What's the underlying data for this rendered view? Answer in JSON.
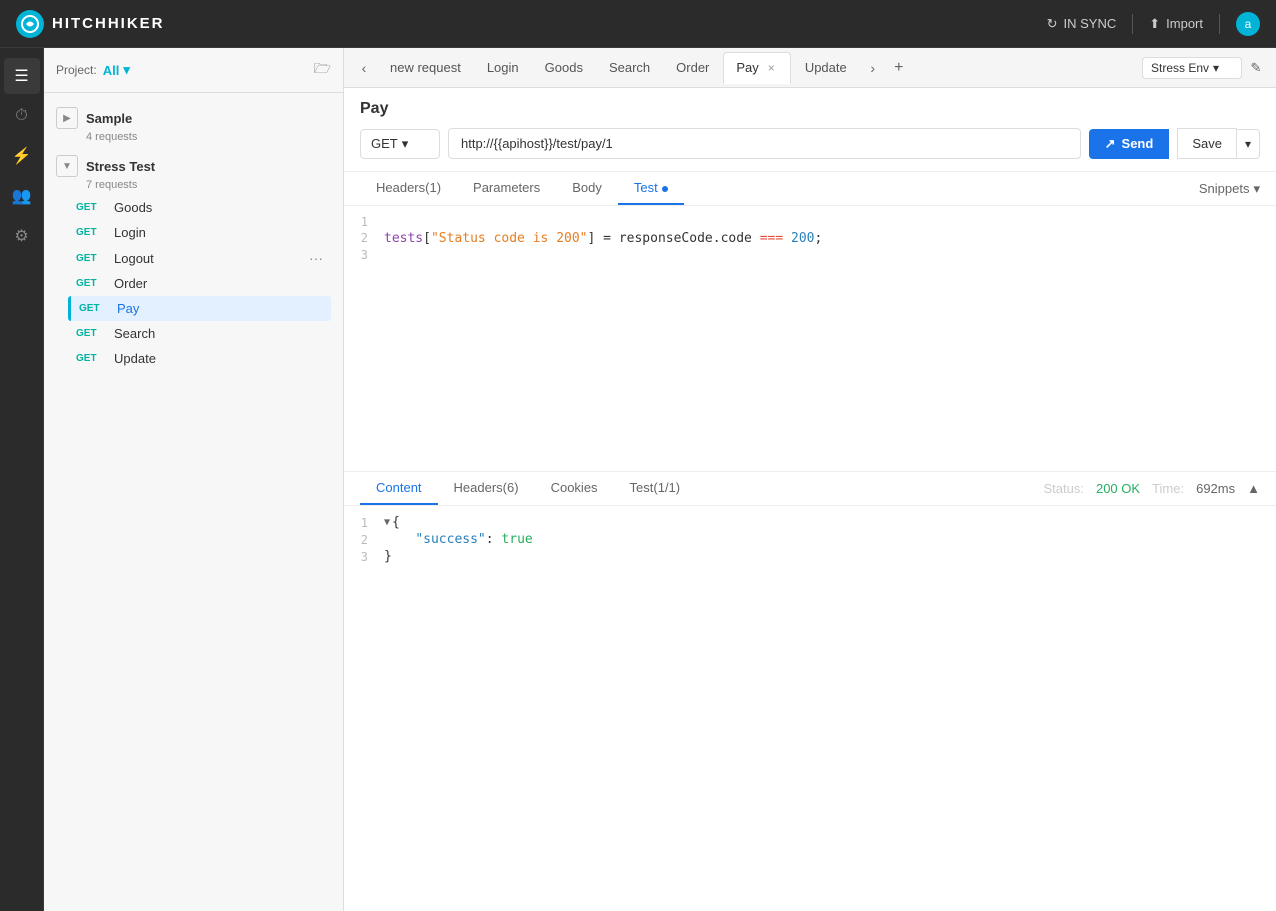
{
  "app": {
    "title": "HITCHHIKER",
    "logo_text": "HITCHHIKER"
  },
  "navbar": {
    "sync_label": "IN SYNC",
    "import_label": "Import",
    "user_initial": "a"
  },
  "sidebar": {
    "icons": [
      {
        "name": "collection-icon",
        "symbol": "☰"
      },
      {
        "name": "history-icon",
        "symbol": "🕐"
      },
      {
        "name": "environment-icon",
        "symbol": "⚡"
      },
      {
        "name": "team-icon",
        "symbol": "👥"
      },
      {
        "name": "settings-icon",
        "symbol": "⚙"
      }
    ]
  },
  "left_panel": {
    "project_label": "Project:",
    "project_value": "All",
    "collections": [
      {
        "name": "Sample",
        "meta": "4 requests",
        "requests": []
      },
      {
        "name": "Stress Test",
        "meta": "7 requests",
        "requests": [
          {
            "method": "GET",
            "name": "Goods",
            "active": false
          },
          {
            "method": "GET",
            "name": "Login",
            "active": false
          },
          {
            "method": "GET",
            "name": "Logout",
            "active": false
          },
          {
            "method": "GET",
            "name": "Order",
            "active": false
          },
          {
            "method": "GET",
            "name": "Pay",
            "active": true
          },
          {
            "method": "GET",
            "name": "Search",
            "active": false
          },
          {
            "method": "GET",
            "name": "Update",
            "active": false
          }
        ]
      }
    ]
  },
  "tabs": [
    {
      "label": "new request",
      "closable": false
    },
    {
      "label": "Login",
      "closable": false
    },
    {
      "label": "Goods",
      "closable": false
    },
    {
      "label": "Search",
      "closable": false
    },
    {
      "label": "Order",
      "closable": false
    },
    {
      "label": "Pay",
      "closable": true,
      "active": true
    },
    {
      "label": "Update",
      "closable": false
    }
  ],
  "env_selector": {
    "value": "Stress Env"
  },
  "request": {
    "title": "Pay",
    "method": "GET",
    "url": "http://{{apihost}}/test/pay/1",
    "sub_tabs": [
      {
        "label": "Headers(1)",
        "active": false
      },
      {
        "label": "Parameters",
        "active": false
      },
      {
        "label": "Body",
        "active": false
      },
      {
        "label": "Test",
        "active": true,
        "dot": true
      }
    ],
    "snippets_label": "Snippets",
    "send_label": "Send",
    "save_label": "Save"
  },
  "test_code": [
    {
      "line": 1,
      "content": ""
    },
    {
      "line": 2,
      "content": "tests[\"Status code is 200\"] = responseCode.code === 200;"
    },
    {
      "line": 3,
      "content": ""
    }
  ],
  "response": {
    "tabs": [
      {
        "label": "Content",
        "active": true
      },
      {
        "label": "Headers(6)",
        "active": false
      },
      {
        "label": "Cookies",
        "active": false
      },
      {
        "label": "Test(1/1)",
        "active": false
      }
    ],
    "status_label": "Status:",
    "status_value": "200 OK",
    "time_label": "Time:",
    "time_value": "692ms",
    "body_lines": [
      {
        "line": 1,
        "content": "{",
        "expand": true
      },
      {
        "line": 2,
        "content": "    \"success\": true"
      },
      {
        "line": 3,
        "content": "}"
      }
    ]
  }
}
